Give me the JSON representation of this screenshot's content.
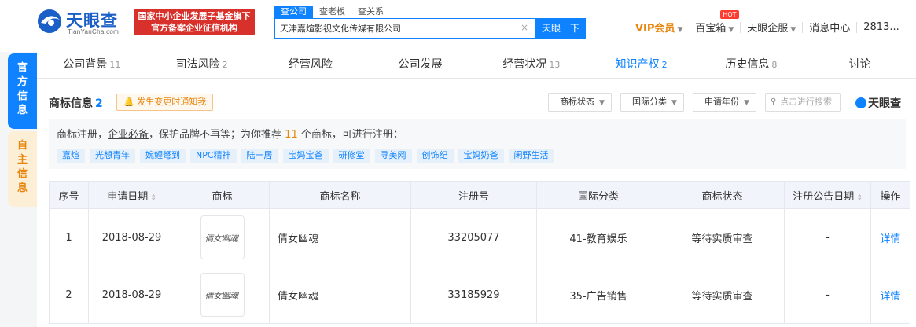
{
  "header": {
    "logo_text": "天眼查",
    "logo_sub": "TianYanCha.com",
    "gov_badge_line1": "国家中小企业发展子基金旗下",
    "gov_badge_line2": "官方备案企业征信机构",
    "search_tabs": [
      "查公司",
      "查老板",
      "查关系"
    ],
    "search_value": "天津嘉煊影视文化传媒有限公司",
    "search_button": "天眼一下",
    "nav": {
      "vip": "VIP会员",
      "treasure": "百宝箱",
      "hot": "HOT",
      "enterprise": "天眼企服",
      "messages": "消息中心",
      "user": "2813..."
    }
  },
  "side_tabs": {
    "official": "官方信息",
    "self": "自主信息"
  },
  "tabs": [
    {
      "label": "公司背景",
      "count": "11"
    },
    {
      "label": "司法风险",
      "count": "2"
    },
    {
      "label": "经营风险",
      "count": ""
    },
    {
      "label": "公司发展",
      "count": ""
    },
    {
      "label": "经营状况",
      "count": "13"
    },
    {
      "label": "知识产权",
      "count": "2"
    },
    {
      "label": "历史信息",
      "count": "8"
    },
    {
      "label": "讨论",
      "count": ""
    }
  ],
  "section": {
    "title": "商标信息",
    "count": "2",
    "notify": "发生变更时通知我",
    "filters": [
      "商标状态",
      "国际分类",
      "申请年份"
    ],
    "search_placeholder": "点击进行搜索",
    "brand": "天眼查"
  },
  "recommend": {
    "prefix": "商标注册，",
    "underlined": "企业必备",
    "middle": "，保护品牌不再等；为你推荐 ",
    "number": "11",
    "suffix": " 个商标，可进行注册：",
    "chips": [
      "嘉煊",
      "光想青年",
      "婉鲤弩到",
      "NPC精神",
      "陆一居",
      "宝妈宝爸",
      "研修堂",
      "寻美网",
      "创饰纪",
      "宝妈奶爸",
      "闲野生活"
    ]
  },
  "table": {
    "headers": [
      "序号",
      "申请日期",
      "商标",
      "商标名称",
      "注册号",
      "国际分类",
      "商标状态",
      "注册公告日期",
      "操作"
    ],
    "rows": [
      {
        "index": "1",
        "date": "2018-08-29",
        "mark_text": "倩女幽魂",
        "name": "倩女幽魂",
        "reg_no": "33205077",
        "class": "41-教育娱乐",
        "status": "等待实质审查",
        "pub_date": "-",
        "action": "详情"
      },
      {
        "index": "2",
        "date": "2018-08-29",
        "mark_text": "倩女幽魂",
        "name": "倩女幽魂",
        "reg_no": "33185929",
        "class": "35-广告销售",
        "status": "等待实质审查",
        "pub_date": "-",
        "action": "详情"
      }
    ]
  }
}
